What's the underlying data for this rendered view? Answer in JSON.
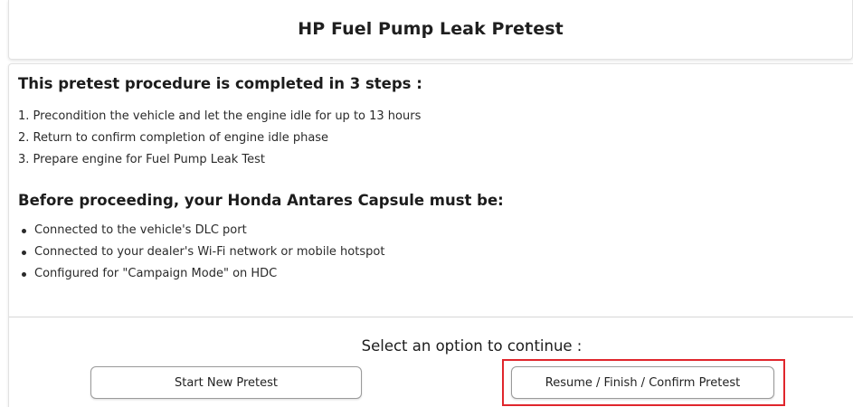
{
  "header": {
    "title": "HP Fuel Pump Leak Pretest"
  },
  "intro": {
    "heading": "This pretest procedure is completed in 3 steps :",
    "steps": [
      "1. Precondition the vehicle and let the engine idle for up to 13 hours",
      "2. Return to confirm completion of engine idle phase",
      "3. Prepare engine for Fuel Pump Leak Test"
    ]
  },
  "requirements": {
    "heading": "Before proceeding, your Honda Antares Capsule must be:",
    "items": [
      "Connected to the vehicle's DLC port",
      "Connected to your dealer's Wi-Fi network or mobile hotspot",
      "Configured for \"Campaign Mode\" on HDC"
    ]
  },
  "options": {
    "prompt": "Select an option to continue :",
    "start_label": "Start New Pretest",
    "resume_label": "Resume / Finish / Confirm Pretest"
  },
  "colors": {
    "highlight_border": "#e0262c",
    "button_border": "#9a9a9a"
  }
}
